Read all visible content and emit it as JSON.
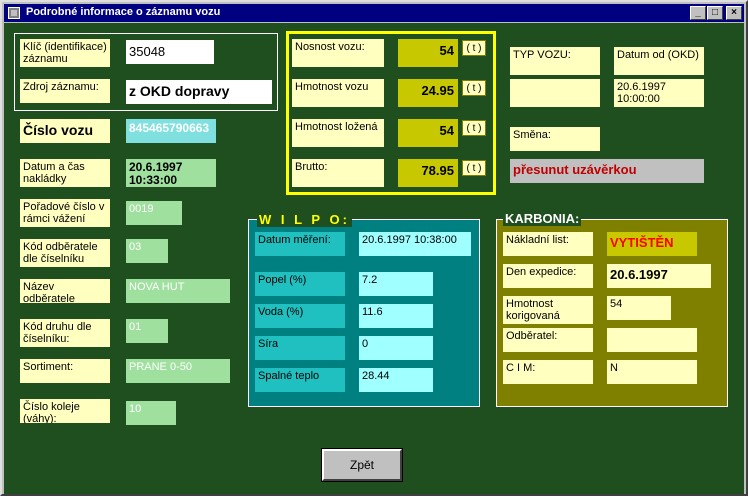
{
  "window": {
    "title": "Podrobné informace o záznamu vozu"
  },
  "left": {
    "klic_label": "Klíč (identifikace) záznamu",
    "klic_value": "35048",
    "zdroj_label": "Zdroj záznamu:",
    "zdroj_value": "z OKD dopravy",
    "cislo_vozu_label": "Číslo vozu",
    "cislo_vozu_value": "845465790663",
    "datum_label": "Datum a čas nakládky",
    "datum_value": "20.6.1997 10:33:00",
    "poradove_label": "Pořadové číslo v rámci vážení",
    "poradove_value": "0019",
    "kod_odb_label": "Kód odběratele dle číselníku",
    "kod_odb_value": "03",
    "nazev_odb_label": "Název odběratele",
    "nazev_odb_value": "NOVA HUT",
    "kod_druhu_label": "Kód druhu dle číselníku:",
    "kod_druhu_value": "01",
    "sortiment_label": "Sortiment:",
    "sortiment_value": "PRANE 0-50",
    "cislo_koleje_label": "Číslo koleje (váhy):",
    "cislo_koleje_value": "10"
  },
  "weights": {
    "nosnost_label": "Nosnost vozu:",
    "nosnost_value": "54",
    "hmotnost_label": "Hmotnost vozu",
    "hmotnost_value": "24.95",
    "lozena_label": "Hmotnost ložená",
    "lozena_value": "54",
    "brutto_label": "Brutto:",
    "brutto_value": "78.95",
    "unit": "( t )"
  },
  "right": {
    "typ_label": "TYP VOZU:",
    "datum_od_label": "Datum od (OKD)",
    "datum_od_value": "20.6.1997 10:00:00",
    "smena_label": "Směna:",
    "status_text": "přesunut uzávěrkou"
  },
  "wilpo": {
    "title": "W I L P O:",
    "datum_label": "Datum měření:",
    "datum_value": "20.6.1997 10:38:00",
    "popel_label": "Popel (%)",
    "popel_value": "7.2",
    "voda_label": "Voda (%)",
    "voda_value": "11.6",
    "sira_label": "Síra",
    "sira_value": "0",
    "spalne_label": "Spalné teplo",
    "spalne_value": "28.44"
  },
  "karbonia": {
    "title": "KARBONIA:",
    "nakladni_label": "Nákladní list:",
    "nakladni_value": "VYTIŠTĚN",
    "expedice_label": "Den expedice:",
    "expedice_value": "20.6.1997",
    "hmotnost_label": "Hmotnost korigovaná",
    "hmotnost_value": "54",
    "odberatel_label": "Odběratel:",
    "cim_label": "C I M:",
    "cim_value": "N"
  },
  "buttons": {
    "zpet": "Zpět",
    "minimize": "_",
    "maximize": "□",
    "close": "×"
  },
  "colors": {
    "background": "#1f4f1f",
    "title_bar": "#000080",
    "wilpo": "#008080",
    "karbonia": "#808000",
    "status": "#c00000"
  }
}
